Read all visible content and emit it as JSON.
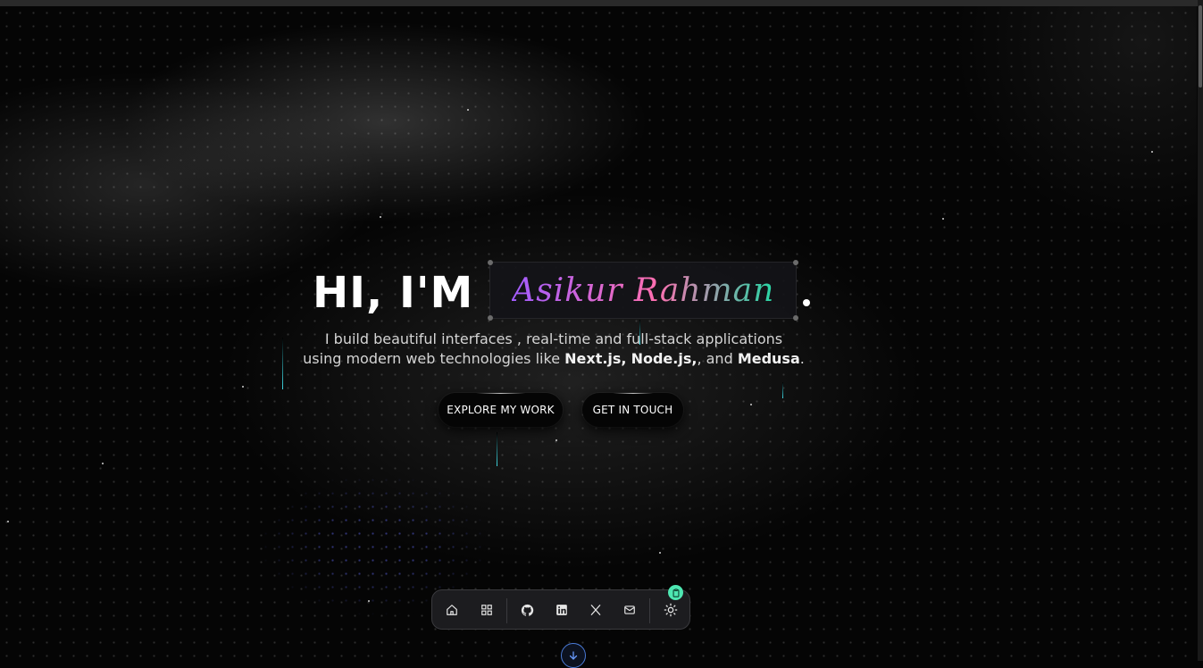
{
  "hero": {
    "greeting": "HI, I'M",
    "name": "Asikur Rahman",
    "subtitle_line1": "I build beautiful interfaces , real-time and full-stack applications",
    "subtitle_line2_prefix": "using modern web technologies like ",
    "tech1": "Next.js,",
    "tech2": "Node.js,",
    "conjunction": ", and ",
    "tech3": "Medusa",
    "end": "."
  },
  "buttons": {
    "explore": "EXPLORE MY WORK",
    "contact": "GET IN TOUCH"
  },
  "dock": {
    "items": [
      {
        "icon": "home-icon"
      },
      {
        "icon": "grid-icon"
      },
      {
        "icon": "github-icon"
      },
      {
        "icon": "linkedin-icon"
      },
      {
        "icon": "x-icon"
      },
      {
        "icon": "mail-icon"
      },
      {
        "icon": "sun-icon"
      }
    ],
    "badge_icon": "clipboard-icon"
  },
  "scroll_icon": "arrow-down-icon",
  "colors": {
    "background": "#050505",
    "name_gradient": [
      "#a25cff",
      "#ff6fb1",
      "#25d7a4"
    ],
    "badge": "#4ee7b2",
    "scroll_ring": "#4a7bd8"
  }
}
